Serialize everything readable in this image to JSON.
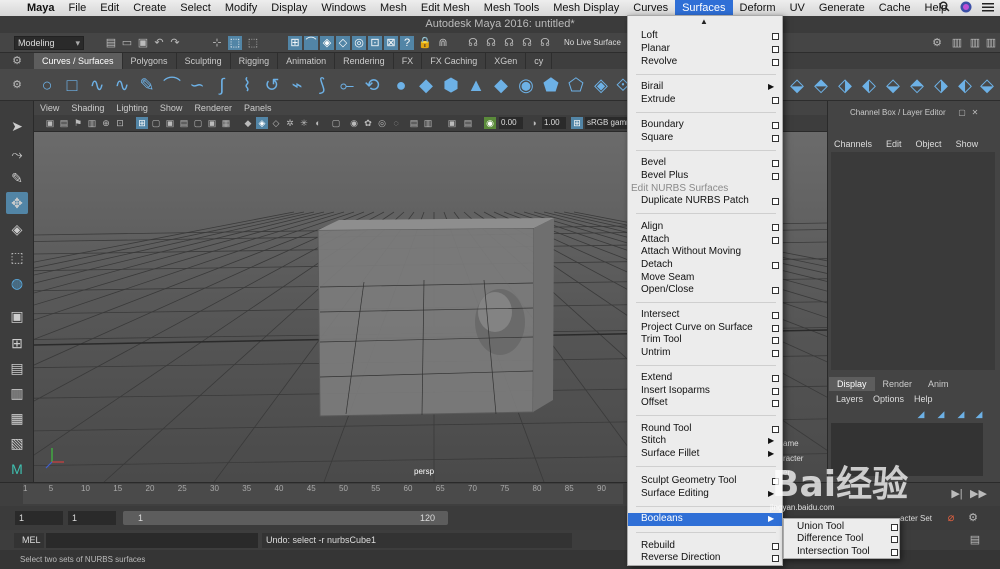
{
  "menubar": {
    "apple": "",
    "app": "Maya",
    "items": [
      "File",
      "Edit",
      "Create",
      "Select",
      "Modify",
      "Display",
      "Windows",
      "Mesh",
      "Edit Mesh",
      "Mesh Tools",
      "Mesh Display",
      "Curves",
      "Surfaces",
      "Deform",
      "UV",
      "Generate",
      "Cache",
      "Help"
    ],
    "active": "Surfaces"
  },
  "title": "Autodesk Maya 2016: untitled*",
  "status": {
    "mode": "Modeling",
    "live_surface": "No Live Surface"
  },
  "shelf_tabs": [
    "Curves / Surfaces",
    "Polygons",
    "Sculpting",
    "Rigging",
    "Animation",
    "Rendering",
    "FX",
    "FX Caching",
    "XGen",
    "cy"
  ],
  "viewport_menu": [
    "View",
    "Shading",
    "Lighting",
    "Show",
    "Renderer",
    "Panels"
  ],
  "viewport_fields": {
    "field1": "0.00",
    "field2": "1.00",
    "colorspace": "sRGB gamma"
  },
  "viewport_label": "persp",
  "channel_box": {
    "title": "Channel Box / Layer Editor",
    "menu": [
      "Channels",
      "Edit",
      "Object",
      "Show"
    ]
  },
  "layer_editor": {
    "tabs": [
      "Display",
      "Render",
      "Anim"
    ],
    "menu": [
      "Layers",
      "Options",
      "Help"
    ]
  },
  "timeline": {
    "ticks": [
      "1",
      "5",
      "10",
      "15",
      "20",
      "25",
      "30",
      "35",
      "40",
      "45",
      "50",
      "55",
      "60",
      "65",
      "70",
      "75",
      "80",
      "85",
      "90"
    ]
  },
  "range": {
    "start": "1",
    "start2": "1",
    "slider_left": "1",
    "slider_right": "120"
  },
  "cmd": {
    "mel": "MEL",
    "undo": "Undo: select -r nurbsCube1"
  },
  "help": "Select two sets of NURBS surfaces",
  "menu": {
    "loft": "Loft",
    "planar": "Planar",
    "revolve": "Revolve",
    "birail": "Birail",
    "extrude": "Extrude",
    "boundary": "Boundary",
    "square": "Square",
    "bevel": "Bevel",
    "bevel_plus": "Bevel Plus",
    "section_header": "Edit NURBS Surfaces",
    "duplicate": "Duplicate NURBS Patch",
    "align": "Align",
    "attach": "Attach",
    "attach_without_moving": "Attach Without Moving",
    "detach": "Detach",
    "move_seam": "Move Seam",
    "open_close": "Open/Close",
    "intersect": "Intersect",
    "project_curve": "Project Curve on Surface",
    "trim_tool": "Trim Tool",
    "untrim": "Untrim",
    "extend": "Extend",
    "insert_isoparms": "Insert Isoparms",
    "offset": "Offset",
    "round_tool": "Round Tool",
    "stitch": "Stitch",
    "surface_fillet": "Surface Fillet",
    "sculpt_geometry": "Sculpt Geometry Tool",
    "surface_editing": "Surface Editing",
    "booleans": "Booleans",
    "rebuild": "Rebuild",
    "reverse_direction": "Reverse Direction"
  },
  "submenu": {
    "union": "Union Tool",
    "difference": "Difference Tool",
    "intersection": "Intersection Tool"
  },
  "panel_fragments": {
    "f1": "ame",
    "f2": "racter",
    "f3": "er",
    "f4": "acter Set"
  },
  "watermark": {
    "text": "Bai经验",
    "sub": "jingyan.baidu.com"
  }
}
